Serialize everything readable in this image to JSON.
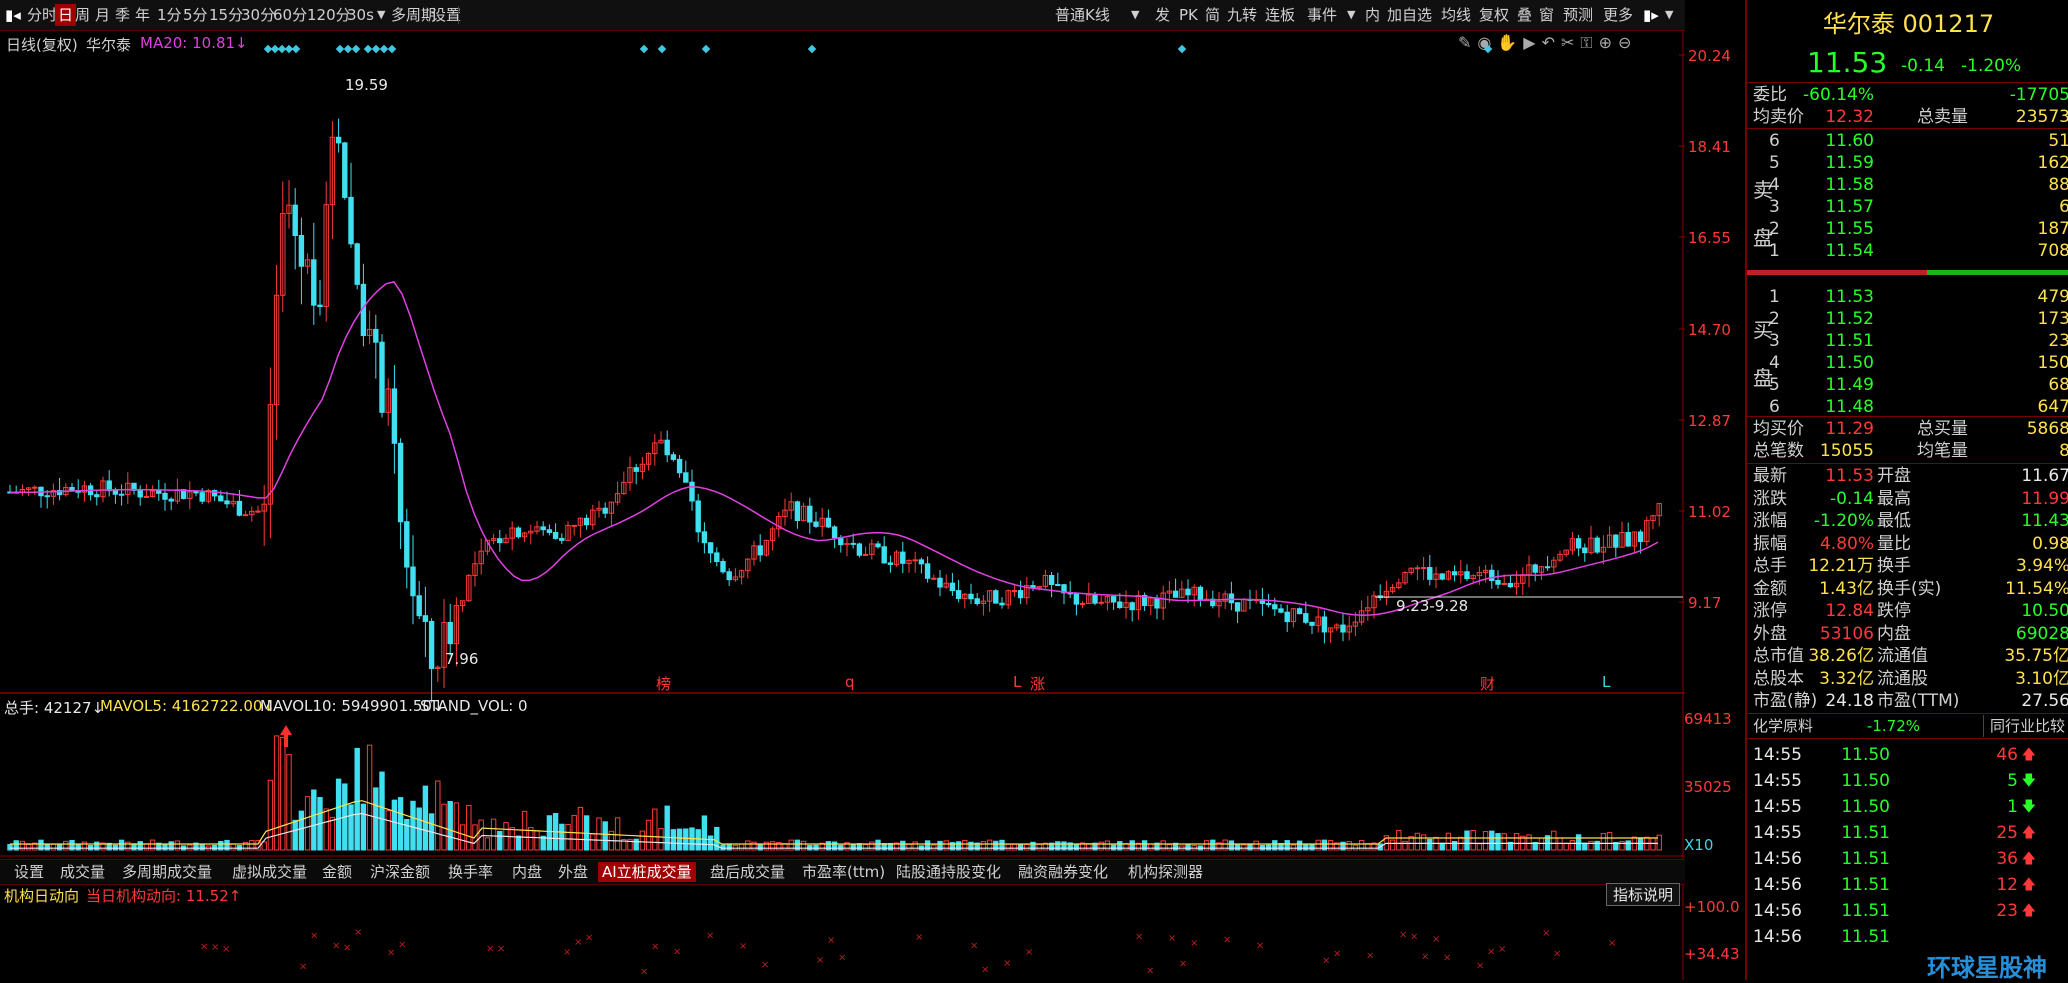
{
  "toolbar": {
    "items": [
      "分时",
      "日",
      "周",
      "月",
      "季",
      "年",
      "1分",
      "5分",
      "15分",
      "30分",
      "60分",
      "120分",
      "30s",
      "多周期",
      "设置"
    ],
    "active_index": 1,
    "kline_select": "普通K线",
    "right_items": [
      "发",
      "PK",
      "简",
      "九转",
      "连板",
      "事件",
      "内",
      "加自选",
      "均线",
      "复权",
      "叠",
      "窗",
      "预测",
      "更多"
    ]
  },
  "chart": {
    "header_left": "日线(复权)",
    "stock_name": "华尔泰",
    "ma_label": "MA20: 10.81↓",
    "price_ticks": [
      "20.24",
      "18.41",
      "16.55",
      "14.70",
      "12.87",
      "11.02",
      "9.17"
    ],
    "high_label": "19.59",
    "low_label": "7.96",
    "range_label": "9.23-9.28",
    "event_marks": [
      "榜",
      "q",
      "L",
      "涨",
      "财",
      "L"
    ],
    "colors": {
      "up": "#ff3a3a",
      "down": "#40e0f0",
      "ma": "#e040e0",
      "grid": "#8a0000"
    }
  },
  "volume": {
    "header": "总手: 42127↓",
    "mavol5": "MAVOL5: 4162722.00↓",
    "mavol10": "MAVOL10: 5949901.50↓",
    "stand": "STAND_VOL: 0",
    "ticks": [
      "69413",
      "35025"
    ],
    "unit": "X10"
  },
  "tabs": [
    "设置",
    "成交量",
    "多周期成交量",
    "虚拟成交量",
    "金额",
    "沪深金额",
    "换手率",
    "内盘",
    "外盘",
    "AI立桩成交量",
    "盘后成交量",
    "市盈率(ttm)",
    "陆股通持股变化",
    "融资融券变化",
    "机构探测器"
  ],
  "tabs_active": 9,
  "institution": {
    "title": "机构日动向",
    "today": "当日机构动向: 11.52↑",
    "explain_btn": "指标说明",
    "ticks": [
      "+100.0",
      "+34.43"
    ]
  },
  "panel": {
    "title": "华尔泰 001217",
    "price": "11.53",
    "change": "-0.14",
    "change_pct": "-1.20%",
    "weibi_label": "委比",
    "weibi": "-60.14%",
    "weicha": "-17705",
    "avg_sell_label": "均卖价",
    "avg_sell": "12.32",
    "total_sell_label": "总卖量",
    "total_sell": "23573",
    "sell_side_label": "卖盘",
    "asks": [
      {
        "lv": "6",
        "p": "11.60",
        "v": "51"
      },
      {
        "lv": "5",
        "p": "11.59",
        "v": "162"
      },
      {
        "lv": "4",
        "p": "11.58",
        "v": "88"
      },
      {
        "lv": "3",
        "p": "11.57",
        "v": "6"
      },
      {
        "lv": "2",
        "p": "11.55",
        "v": "187"
      },
      {
        "lv": "1",
        "p": "11.54",
        "v": "708"
      }
    ],
    "buy_side_label": "买盘",
    "bids": [
      {
        "lv": "1",
        "p": "11.53",
        "v": "479"
      },
      {
        "lv": "2",
        "p": "11.52",
        "v": "173"
      },
      {
        "lv": "3",
        "p": "11.51",
        "v": "23"
      },
      {
        "lv": "4",
        "p": "11.50",
        "v": "150"
      },
      {
        "lv": "5",
        "p": "11.49",
        "v": "68"
      },
      {
        "lv": "6",
        "p": "11.48",
        "v": "647"
      }
    ],
    "avg_buy_label": "均买价",
    "avg_buy": "11.29",
    "total_buy_label": "总买量",
    "total_buy": "5868",
    "total_trades_label": "总笔数",
    "total_trades": "15055",
    "avg_trade_label": "均笔量",
    "avg_trade": "8",
    "stats": [
      {
        "l1": "最新",
        "v1": "11.53",
        "c1": "red",
        "l2": "开盘",
        "v2": "11.67",
        "c2": "white"
      },
      {
        "l1": "涨跌",
        "v1": "-0.14",
        "c1": "green",
        "l2": "最高",
        "v2": "11.99",
        "c2": "red"
      },
      {
        "l1": "涨幅",
        "v1": "-1.20%",
        "c1": "green",
        "l2": "最低",
        "v2": "11.43",
        "c2": "green"
      },
      {
        "l1": "振幅",
        "v1": "4.80%",
        "c1": "red",
        "l2": "量比",
        "v2": "0.98",
        "c2": "yellow"
      },
      {
        "l1": "总手",
        "v1": "12.21万",
        "c1": "yellow",
        "l2": "换手",
        "v2": "3.94%",
        "c2": "yellow"
      },
      {
        "l1": "金额",
        "v1": "1.43亿",
        "c1": "yellow",
        "l2": "换手(实)",
        "v2": "11.54%",
        "c2": "yellow"
      },
      {
        "l1": "涨停",
        "v1": "12.84",
        "c1": "red",
        "l2": "跌停",
        "v2": "10.50",
        "c2": "green"
      },
      {
        "l1": "外盘",
        "v1": "53106",
        "c1": "red",
        "l2": "内盘",
        "v2": "69028",
        "c2": "green"
      },
      {
        "l1": "总市值",
        "v1": "38.26亿",
        "c1": "yellow",
        "l2": "流通值",
        "v2": "35.75亿",
        "c2": "yellow"
      },
      {
        "l1": "总股本",
        "v1": "3.32亿",
        "c1": "yellow",
        "l2": "流通股",
        "v2": "3.10亿",
        "c2": "yellow"
      },
      {
        "l1": "市盈(静)",
        "v1": "24.18",
        "c1": "white",
        "l2": "市盈(TTM)",
        "v2": "27.56",
        "c2": "white"
      }
    ],
    "industry": "化学原料",
    "industry_pct": "-1.72%",
    "peer_btn": "同行业比较",
    "ticks": [
      {
        "t": "14:55",
        "p": "11.50",
        "v": "46",
        "dir": "up"
      },
      {
        "t": "14:55",
        "p": "11.50",
        "v": "5",
        "dir": "down"
      },
      {
        "t": "14:55",
        "p": "11.50",
        "v": "1",
        "dir": "down"
      },
      {
        "t": "14:55",
        "p": "11.51",
        "v": "25",
        "dir": "up"
      },
      {
        "t": "14:56",
        "p": "11.51",
        "v": "36",
        "dir": "up"
      },
      {
        "t": "14:56",
        "p": "11.51",
        "v": "12",
        "dir": "up"
      },
      {
        "t": "14:56",
        "p": "11.51",
        "v": "23",
        "dir": "up"
      },
      {
        "t": "14:56",
        "p": "11.51",
        "v": "",
        "dir": ""
      }
    ],
    "watermark": "环球星股神"
  }
}
